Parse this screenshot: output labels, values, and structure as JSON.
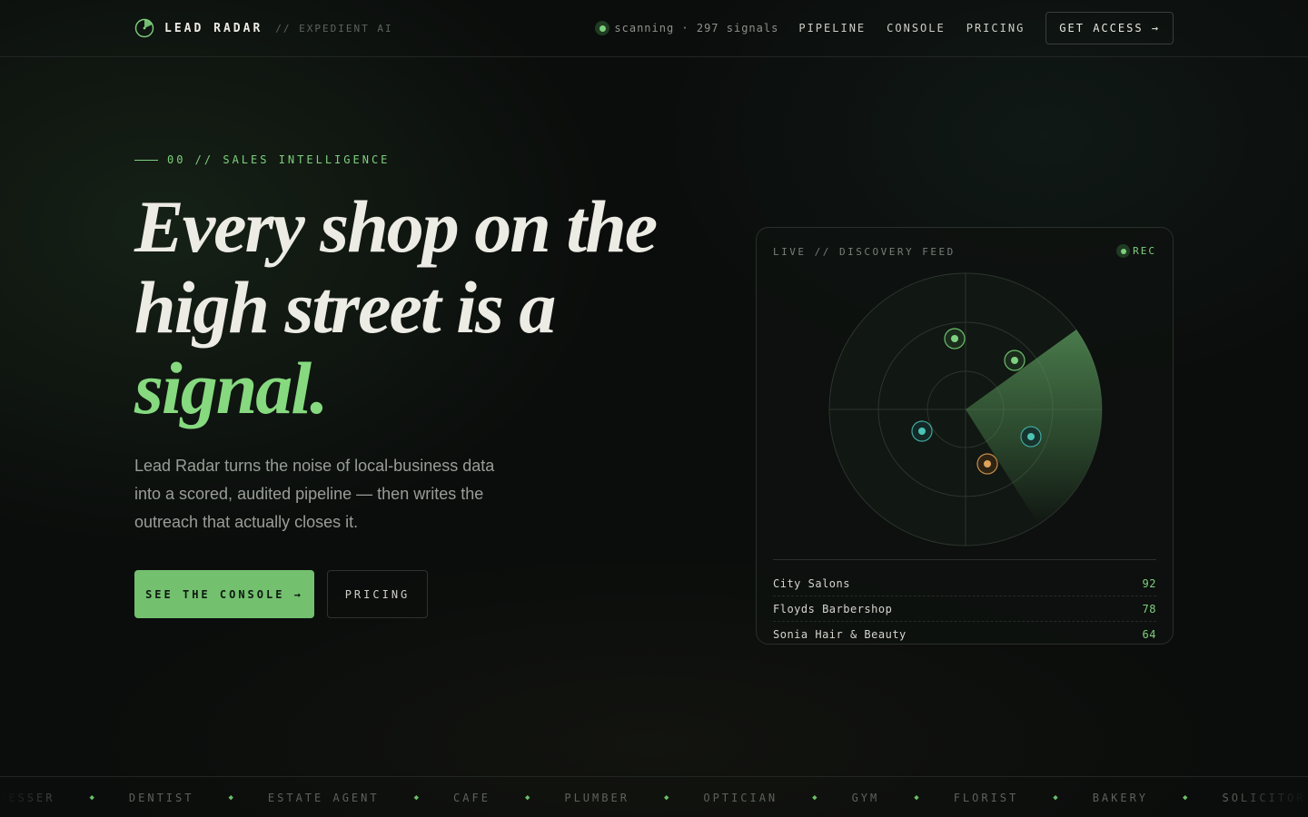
{
  "header": {
    "brand": "LEAD RADAR",
    "brand_sub": "// EXPEDIENT AI",
    "status_text": "scanning · 297 signals",
    "nav": [
      {
        "label": "PIPELINE"
      },
      {
        "label": "CONSOLE"
      },
      {
        "label": "PRICING"
      }
    ],
    "cta": "GET ACCESS →"
  },
  "hero": {
    "eyebrow": "00 // SALES INTELLIGENCE",
    "headline_line1": "Every shop on the",
    "headline_line2": "high street is a",
    "headline_accent": "signal.",
    "lede": "Lead Radar turns the noise of local-business data into a scored, audited pipeline — then writes the outreach that actually closes it.",
    "primary_button": "SEE THE CONSOLE →",
    "secondary_button": "PRICING"
  },
  "feed": {
    "title": "LIVE // DISCOVERY FEED",
    "rec_label": "REC",
    "items": [
      {
        "name": "City Salons",
        "score": "92"
      },
      {
        "name": "Floyds Barbershop",
        "score": "78"
      },
      {
        "name": "Sonia Hair & Beauty",
        "score": "64"
      }
    ]
  },
  "ticker": {
    "items": [
      "HAIRDRESSER",
      "DENTIST",
      "ESTATE AGENT",
      "CAFE",
      "PLUMBER",
      "OPTICIAN",
      "GYM",
      "FLORIST",
      "BAKERY",
      "SOLICITOR"
    ]
  },
  "colors": {
    "accent": "#86d97f",
    "background": "#0b0d0c",
    "blip_green": "#7ed07e",
    "blip_teal": "#4cc3b4",
    "blip_amber": "#e0a35a"
  },
  "icons": {
    "logo": "radar-logo-icon",
    "status": "status-dot-icon",
    "ticker_separator": "diamond-icon"
  }
}
